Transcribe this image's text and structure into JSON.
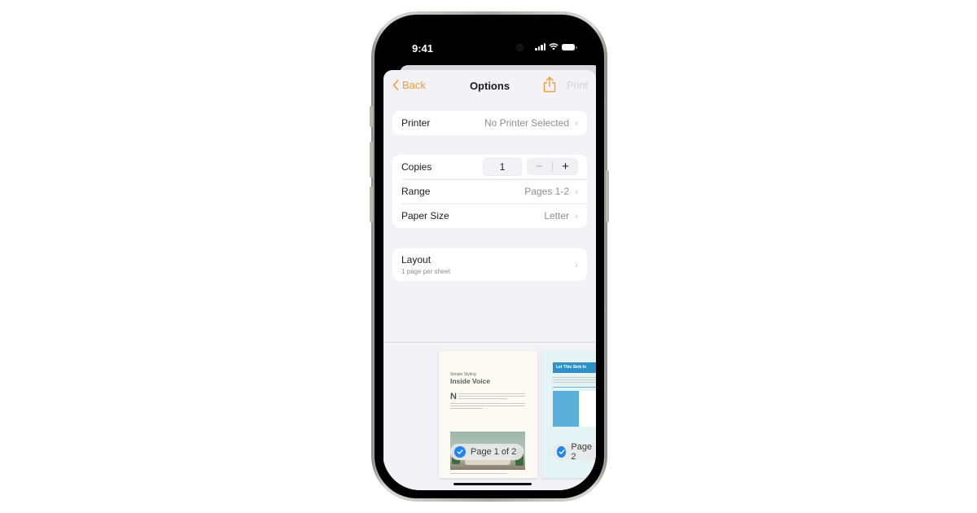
{
  "status_bar": {
    "time": "9:41"
  },
  "nav": {
    "back_label": "Back",
    "title": "Options",
    "share_icon": "share-icon",
    "print_label": "Print"
  },
  "colors": {
    "accent": "#f49a38",
    "check": "#1e86f0",
    "disabled": "#d1d1d6",
    "secondary_text": "#8e8e93"
  },
  "printer": {
    "label": "Printer",
    "value": "No Printer Selected"
  },
  "copies": {
    "label": "Copies",
    "value": "1",
    "decrement": "−",
    "increment": "+"
  },
  "range": {
    "label": "Range",
    "value": "Pages 1-2"
  },
  "paper_size": {
    "label": "Paper Size",
    "value": "Letter"
  },
  "layout": {
    "label": "Layout",
    "subtitle": "1 page per sheet"
  },
  "previews": [
    {
      "kicker": "Simple Styling",
      "title": "Inside Voice",
      "drop_cap": "N",
      "badge": "Page 1 of 2",
      "selected": true
    },
    {
      "title": "Let This Sink In",
      "badge": "Page 2",
      "selected": true
    }
  ]
}
